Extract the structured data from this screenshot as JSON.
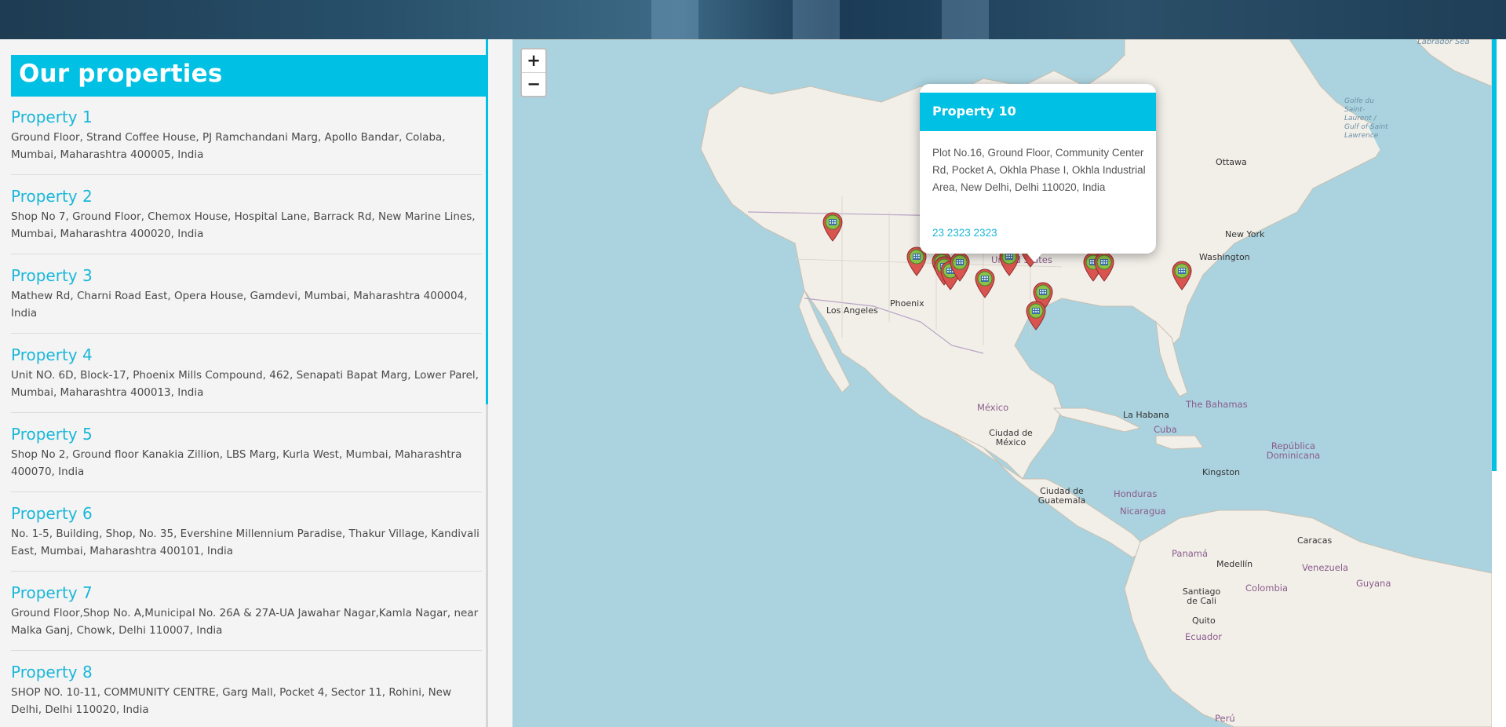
{
  "sidebar": {
    "title": "Our properties",
    "properties": [
      {
        "name": "Property 1",
        "address": "Ground Floor, Strand Coffee House, PJ Ramchandani Marg, Apollo Bandar, Colaba, Mumbai, Maharashtra 400005, India"
      },
      {
        "name": "Property 2",
        "address": "Shop No 7, Ground Floor, Chemox House, Hospital Lane, Barrack Rd, New Marine Lines, Mumbai, Maharashtra 400020, India"
      },
      {
        "name": "Property 3",
        "address": "Mathew Rd, Charni Road East, Opera House, Gamdevi, Mumbai, Maharashtra 400004, India"
      },
      {
        "name": "Property 4",
        "address": "Unit NO. 6D, Block-17, Phoenix Mills Compound, 462, Senapati Bapat Marg, Lower Parel, Mumbai, Maharashtra 400013, India"
      },
      {
        "name": "Property 5",
        "address": "Shop No 2, Ground floor Kanakia Zillion, LBS Marg, Kurla West, Mumbai, Maharashtra 400070, India"
      },
      {
        "name": "Property 6",
        "address": "No. 1-5, Building, Shop, No. 35, Evershine Millennium Paradise, Thakur Village, Kandivali East, Mumbai, Maharashtra 400101, India"
      },
      {
        "name": "Property 7",
        "address": "Ground Floor,Shop No. A,Municipal No. 26A & 27A-UA Jawahar Nagar,Kamla Nagar, near Malka Ganj, Chowk, Delhi 110007, India"
      },
      {
        "name": "Property 8",
        "address": "SHOP NO. 10-11, COMMUNITY CENTRE, Garg Mall, Pocket 4, Sector 11, Rohini, New Delhi, Delhi 110020, India"
      }
    ]
  },
  "map": {
    "zoom_in": "+",
    "zoom_out": "−",
    "labels": {
      "labrador_sea": "Labrador Sea",
      "gulf_st_lawrence": "Golfe du Saint-Laurent / Gulf of Saint Lawrence",
      "ottawa": "Ottawa",
      "new_york": "New York",
      "washington": "Washington",
      "los_angeles": "Los Angeles",
      "phoenix": "Phoenix",
      "united_states": "United States",
      "mexico": "México",
      "ciudad_de_mexico": "Ciudad de México",
      "la_habana": "La Habana",
      "the_bahamas": "The Bahamas",
      "cuba": "Cuba",
      "republica_dominicana": "República Dominicana",
      "kingston": "Kingston",
      "ciudad_de_guatemala": "Ciudad de Guatemala",
      "honduras": "Honduras",
      "nicaragua": "Nicaragua",
      "panama": "Panamá",
      "caracas": "Caracas",
      "venezuela": "Venezuela",
      "medellin": "Medellín",
      "guyana": "Guyana",
      "colombia": "Colombia",
      "santiago_de_cali": "Santiago de Cali",
      "quito": "Quito",
      "ecuador": "Ecuador",
      "peru": "Perú"
    },
    "marker_icon": "map-pin-icon",
    "popup": {
      "title": "Property 10",
      "address": "Plot No.16, Ground Floor, Community Center Rd, Pocket A, Okhla Phase I, Okhla Industrial Area, New Delhi, Delhi 110020, India",
      "phone": "23 2323 2323"
    }
  },
  "colors": {
    "accent": "#00c0e3",
    "water": "#aad3df",
    "land": "#f2efe9",
    "marker_red": "#d9534f",
    "marker_green": "#8bc34a"
  }
}
